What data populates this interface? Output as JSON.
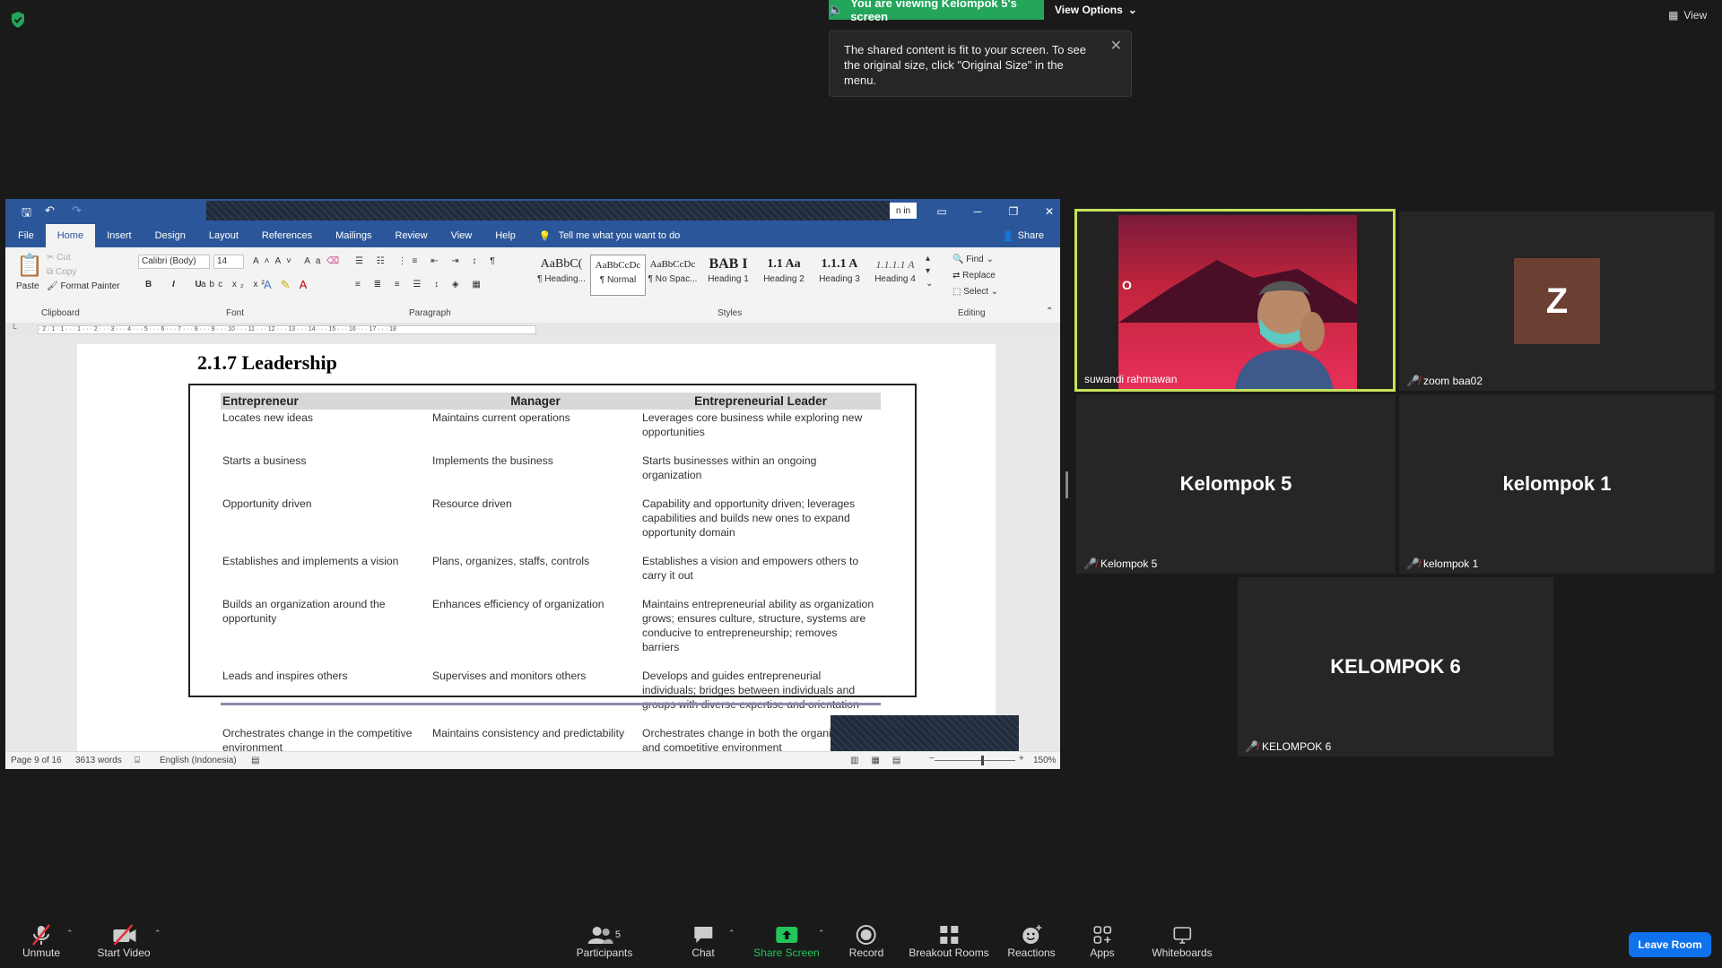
{
  "top": {
    "banner_text": "You are viewing Kelompok 5's screen",
    "view_options": "View Options",
    "view_label": "View",
    "tooltip_text": "The shared content is fit to your screen. To see the original size, click \"Original Size\" in the menu."
  },
  "word": {
    "signin": "n in",
    "tabs": [
      "File",
      "Home",
      "Insert",
      "Design",
      "Layout",
      "References",
      "Mailings",
      "Review",
      "View",
      "Help"
    ],
    "tell_me": "Tell me what you want to do",
    "share": "Share",
    "clipboard": {
      "paste": "Paste",
      "cut": "Cut",
      "copy": "Copy",
      "format_painter": "Format Painter",
      "label": "Clipboard"
    },
    "font": {
      "name": "Calibri (Body)",
      "size": "14",
      "label": "Font"
    },
    "paragraph_label": "Paragraph",
    "styles": [
      {
        "preview": "AaBbC(",
        "name": "¶ Heading..."
      },
      {
        "preview": "AaBbCcDc",
        "name": "¶ Normal"
      },
      {
        "preview": "AaBbCcDc",
        "name": "¶ No Spac..."
      },
      {
        "preview": "BAB I",
        "name": "Heading 1"
      },
      {
        "preview": "1.1 Aa",
        "name": "Heading 2"
      },
      {
        "preview": "1.1.1 A",
        "name": "Heading 3"
      },
      {
        "preview": "1.1.1.1 A",
        "name": "Heading 4"
      }
    ],
    "styles_label": "Styles",
    "editing": {
      "find": "Find",
      "replace": "Replace",
      "select": "Select",
      "label": "Editing"
    },
    "ruler": "· 2 · 1 · 1 · · · 1 · · · 2 · · · 3 · · · 4 · · · 5 · · · 6 · · · 7 · · · 8 · · · 9 · · · 10 · · · 11 · · · 12 · · · 13 · · · 14 · · · 15 · · · 16 · · · 17 · · · 18",
    "document": {
      "heading": "2.1.7   Leadership",
      "columns": [
        "Entrepreneur",
        "Manager",
        "Entrepreneurial Leader"
      ],
      "rows": [
        [
          "Locates new ideas",
          "Maintains current operations",
          "Leverages core business while exploring new opportunities"
        ],
        [
          "Starts a business",
          "Implements the business",
          "Starts businesses within an ongoing organization"
        ],
        [
          "Opportunity driven",
          "Resource driven",
          "Capability and opportunity driven; leverages capabilities and builds new ones to expand opportunity domain"
        ],
        [
          "Establishes and implements a vision",
          "Plans, organizes, staffs, controls",
          "Establishes a vision and empowers others to carry it out"
        ],
        [
          "Builds an organization around the opportunity",
          "Enhances efficiency of organization",
          "Maintains entrepreneurial ability as organization grows; ensures culture, structure, systems are conducive to entrepreneurship; removes barriers"
        ],
        [
          "Leads and inspires others",
          "Supervises and monitors others",
          "Develops and guides entrepreneurial individuals; bridges between individuals and groups with diverse expertise and orientation"
        ],
        [
          "Orchestrates change in the competitive environment",
          "Maintains consistency and predictability",
          "Orchestrates change in both the organizational and competitive environment"
        ]
      ]
    },
    "status": {
      "page": "Page 9 of 16",
      "words": "3613 words",
      "language": "English (Indonesia)",
      "zoom": "150%"
    }
  },
  "participants": [
    {
      "name": "suwandi rahmawan",
      "muted": false
    },
    {
      "name": "zoom baa02",
      "initial": "Z",
      "muted": true
    },
    {
      "name": "Kelompok 5",
      "big": "Kelompok 5",
      "muted": true
    },
    {
      "name": "kelompok 1",
      "big": "kelompok 1",
      "muted": true
    },
    {
      "name": "KELOMPOK 6",
      "big": "KELOMPOK 6",
      "muted": true
    }
  ],
  "toolbar": {
    "unmute": "Unmute",
    "start_video": "Start Video",
    "participants": "Participants",
    "participants_count": "5",
    "chat": "Chat",
    "share_screen": "Share Screen",
    "record": "Record",
    "breakout": "Breakout Rooms",
    "reactions": "Reactions",
    "apps": "Apps",
    "whiteboards": "Whiteboards",
    "leave": "Leave Room"
  },
  "colors": {
    "banner": "#23a55a",
    "active_speaker": "#c6e25c",
    "word_blue": "#2b579a",
    "leave": "#0e72ed",
    "avatar": "#6b3f32"
  }
}
